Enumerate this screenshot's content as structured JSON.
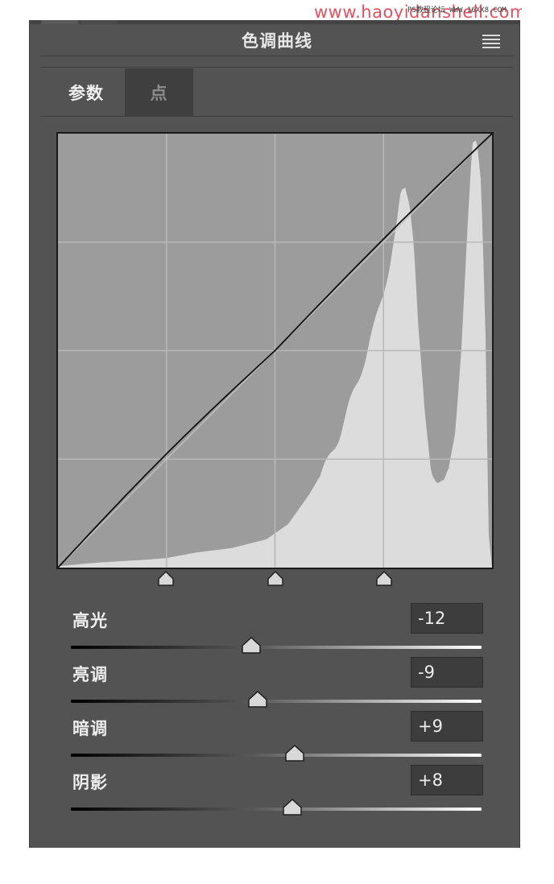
{
  "watermark": {
    "site": "www.haoyidanshell.com",
    "small": "PS教程论坛 WWW.16XX8.COM"
  },
  "panel": {
    "title": "色调曲线",
    "menu_icon": "hamburger-menu-icon"
  },
  "tabs": [
    {
      "label": "参数",
      "active": true
    },
    {
      "label": "点",
      "active": false
    }
  ],
  "curve": {
    "region_dividers": [
      25,
      50,
      75
    ],
    "histogram_color": "#dcdcdc",
    "background_color": "#9c9c9c",
    "curve_color": "#111111"
  },
  "sliders": [
    {
      "name": "highlights",
      "label": "高光",
      "value": "-12",
      "fraction": 0.44
    },
    {
      "name": "lights",
      "label": "亮调",
      "value": "-9",
      "fraction": 0.455
    },
    {
      "name": "darks",
      "label": "暗调",
      "value": "+9",
      "fraction": 0.545
    },
    {
      "name": "shadows",
      "label": "阴影",
      "value": "+8",
      "fraction": 0.54
    }
  ]
}
